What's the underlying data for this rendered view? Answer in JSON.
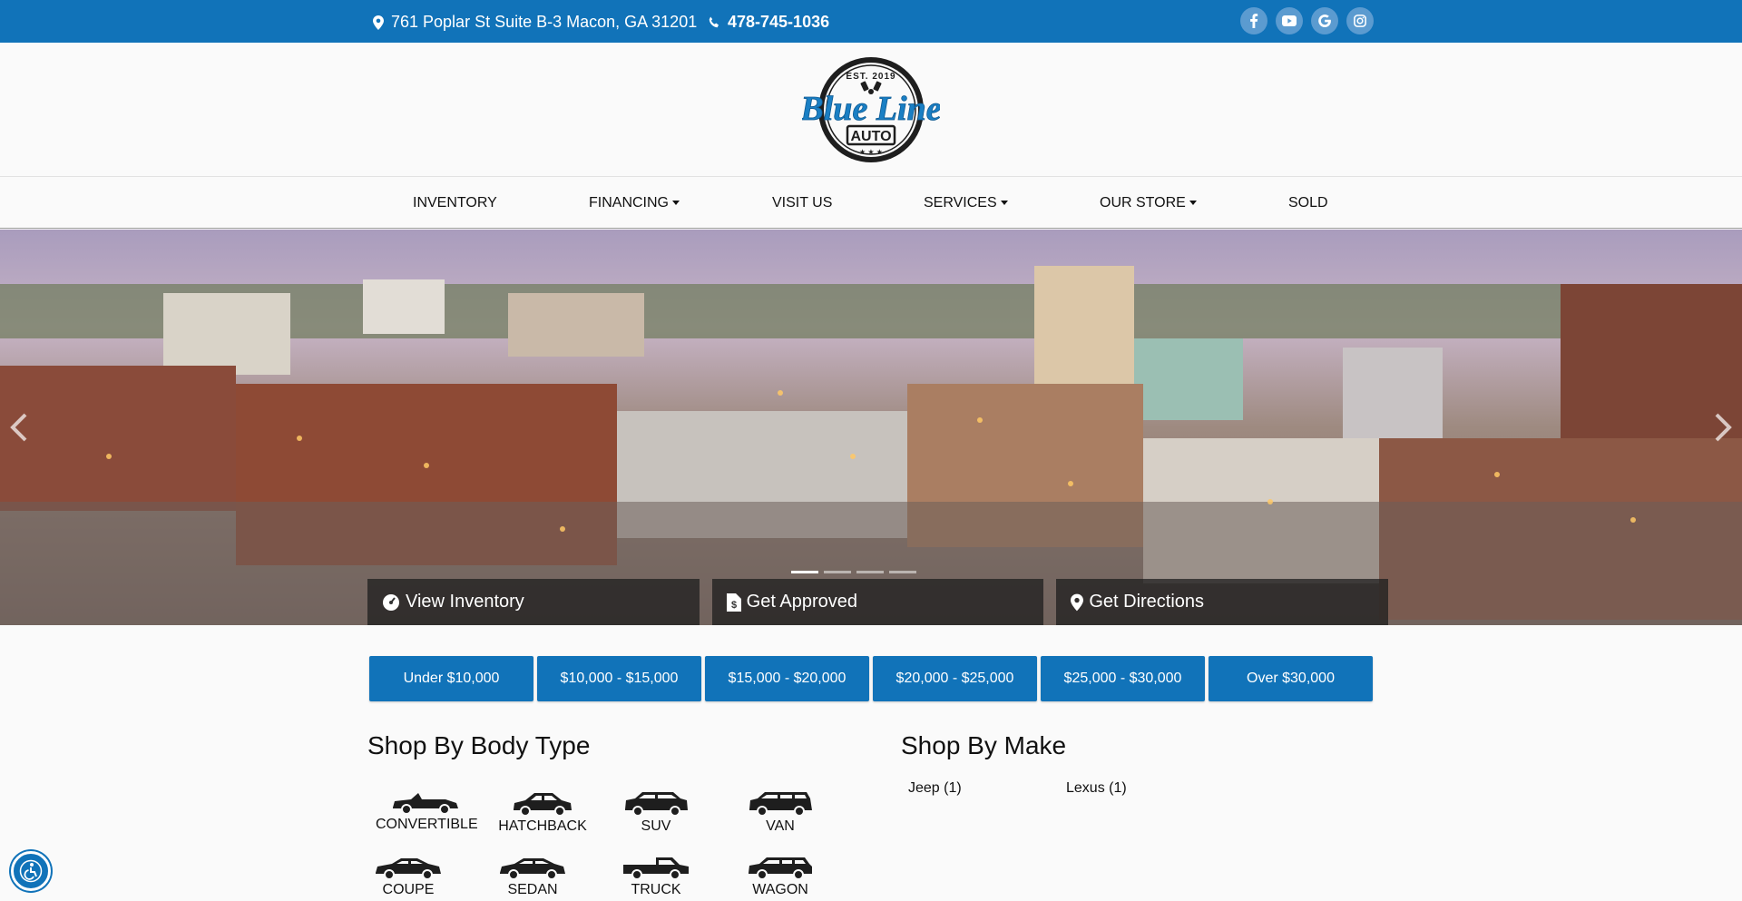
{
  "topbar": {
    "address": "761 Poplar St Suite B-3 Macon, GA 31201",
    "phone": "478-745-1036",
    "socials": [
      "facebook-icon",
      "youtube-icon",
      "google-icon",
      "instagram-icon"
    ],
    "color": "#1173b9"
  },
  "logo": {
    "est": "EST. 2019",
    "name": "Blue Line",
    "sub": "AUTO"
  },
  "nav": {
    "items": [
      {
        "label": "INVENTORY",
        "dropdown": false
      },
      {
        "label": "FINANCING",
        "dropdown": true
      },
      {
        "label": "VISIT US",
        "dropdown": false
      },
      {
        "label": "SERVICES",
        "dropdown": true
      },
      {
        "label": "OUR STORE",
        "dropdown": true
      },
      {
        "label": "SOLD",
        "dropdown": false
      }
    ]
  },
  "hero": {
    "cta": [
      {
        "label": "View Inventory",
        "icon": "speedometer-icon"
      },
      {
        "label": "Get Approved",
        "icon": "dollar-document-icon"
      },
      {
        "label": "Get Directions",
        "icon": "map-pin-icon"
      }
    ]
  },
  "price_ranges": [
    "Under $10,000",
    "$10,000 - $15,000",
    "$15,000 - $20,000",
    "$20,000 - $25,000",
    "$25,000 - $30,000",
    "Over $30,000"
  ],
  "body_types": {
    "title": "Shop By Body Type",
    "items": [
      "CONVERTIBLE",
      "HATCHBACK",
      "SUV",
      "VAN",
      "COUPE",
      "SEDAN",
      "TRUCK",
      "WAGON"
    ]
  },
  "makes": {
    "title": "Shop By Make",
    "items": [
      "Jeep (1)",
      "Lexus (1)"
    ]
  }
}
